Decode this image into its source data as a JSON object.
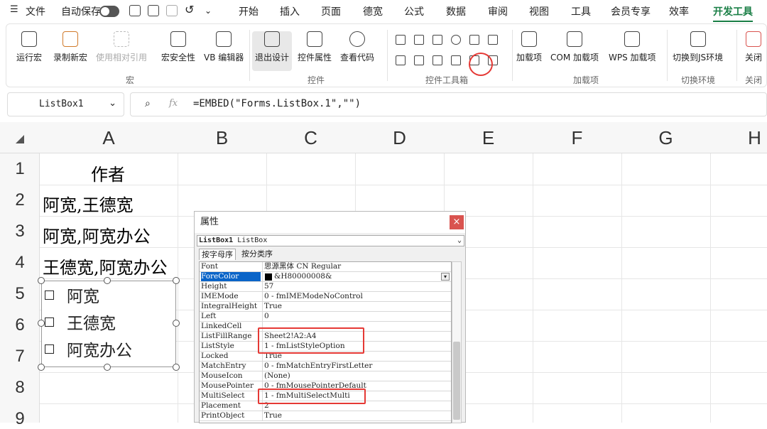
{
  "menubar": {
    "file": "文件",
    "autosave": "自动保存",
    "tabs": [
      "开始",
      "插入",
      "页面",
      "德宽",
      "公式",
      "数据",
      "审阅",
      "视图",
      "工具",
      "会员专享",
      "效率",
      "开发工具"
    ],
    "active_tab": "开发工具",
    "active_color": "#1a7f46"
  },
  "ribbon": {
    "macro_group": {
      "label": "宏",
      "buttons": [
        "运行宏",
        "录制新宏",
        "使用相对引用",
        "宏安全性",
        "VB 编辑器"
      ]
    },
    "control_group": {
      "label": "控件",
      "buttons": [
        "退出设计",
        "控件属性",
        "查看代码"
      ]
    },
    "toolbox_group": {
      "label": "控件工具箱"
    },
    "addin_group": {
      "label": "加载项",
      "buttons": [
        "加载项",
        "COM 加载项",
        "WPS 加载项"
      ]
    },
    "env_group": {
      "label": "切换环境",
      "buttons": [
        "切换到JS环境"
      ]
    },
    "close_group": {
      "label": "关闭",
      "buttons": [
        "关闭"
      ]
    }
  },
  "namebox": {
    "value": "ListBox1"
  },
  "formula": {
    "fx": "fx",
    "value": "=EMBED(\"Forms.ListBox.1\",\"\")"
  },
  "sheet": {
    "columns": [
      "A",
      "B",
      "C",
      "D",
      "E",
      "F",
      "G",
      "H"
    ],
    "rows": [
      "1",
      "2",
      "3",
      "4",
      "5",
      "6",
      "7",
      "8",
      "9"
    ],
    "cells": {
      "A1": "作者",
      "A2": "阿宽,王德宽",
      "A3": "阿宽,阿宽办公",
      "A4": "王德宽,阿宽办公"
    }
  },
  "listbox": {
    "items": [
      "阿宽",
      "王德宽",
      "阿宽办公"
    ]
  },
  "properties": {
    "title": "属性",
    "close": "×",
    "object_name": "ListBox1",
    "object_type": "ListBox",
    "tab_alpha": "按字母序",
    "tab_category": "按分类序",
    "rows": [
      {
        "name": "Font",
        "value": "思源黑体 CN Regular"
      },
      {
        "name": "ForeColor",
        "value": "&H80000008&"
      },
      {
        "name": "Height",
        "value": "57"
      },
      {
        "name": "IMEMode",
        "value": "0 - fmIMEModeNoControl"
      },
      {
        "name": "IntegralHeight",
        "value": "True"
      },
      {
        "name": "Left",
        "value": "0"
      },
      {
        "name": "LinkedCell",
        "value": ""
      },
      {
        "name": "ListFillRange",
        "value": "Sheet2!A2:A4"
      },
      {
        "name": "ListStyle",
        "value": "1 - fmListStyleOption"
      },
      {
        "name": "Locked",
        "value": "True"
      },
      {
        "name": "MatchEntry",
        "value": "0 - fmMatchEntryFirstLetter"
      },
      {
        "name": "MouseIcon",
        "value": "(None)"
      },
      {
        "name": "MousePointer",
        "value": "0 - fmMousePointerDefault"
      },
      {
        "name": "MultiSelect",
        "value": "1 - fmMultiSelectMulti"
      },
      {
        "name": "Placement",
        "value": "2"
      },
      {
        "name": "PrintObject",
        "value": "True"
      }
    ]
  }
}
